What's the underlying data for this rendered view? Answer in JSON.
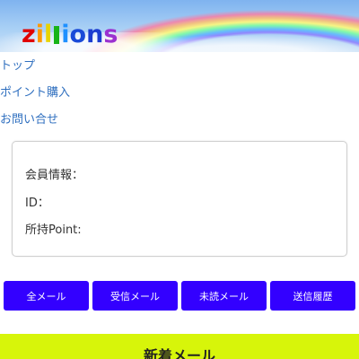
{
  "header": {
    "logo_letters": [
      {
        "char": "z",
        "color": "#e00000"
      },
      {
        "char": "i",
        "color": "#ff9900"
      },
      {
        "char": "l",
        "color": "#e8d400"
      },
      {
        "char": "",
        "color": "#18b418"
      },
      {
        "char": "i",
        "color": "#1e90ff"
      },
      {
        "char": "o",
        "color": "#1a4bd8"
      },
      {
        "char": "n",
        "color": "#1a3cd0"
      },
      {
        "char": "s",
        "color": "#9b30d0"
      }
    ]
  },
  "nav": {
    "items": [
      {
        "label": "トップ"
      },
      {
        "label": "ポイント購入"
      },
      {
        "label": "お問い合せ"
      }
    ]
  },
  "member_info": {
    "member_label": "会員情報：",
    "id_label": "ID：",
    "points_label": "所持Point:"
  },
  "buttons": {
    "items": [
      {
        "label": "全メール"
      },
      {
        "label": "受信メール"
      },
      {
        "label": "未読メール"
      },
      {
        "label": "送信履歴"
      }
    ]
  },
  "newmail": {
    "title": "新着メール"
  },
  "colors": {
    "button_bg": "#3300ff",
    "newmail_bg": "#d7f50a",
    "link": "#2f6fbf"
  }
}
